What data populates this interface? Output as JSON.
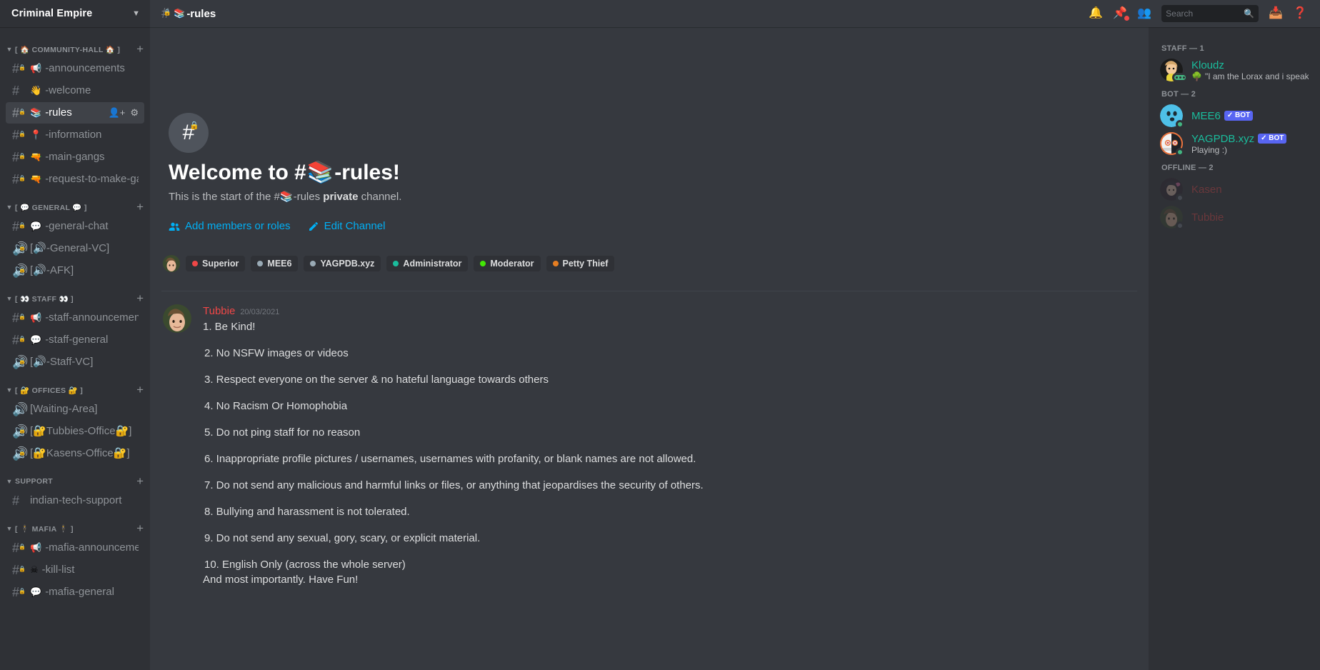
{
  "server": {
    "name": "Criminal Empire",
    "chevron_icon": "chevron-down-icon"
  },
  "sidebar": {
    "categories": [
      {
        "name": "[ 🏠 COMMUNITY-HALL 🏠 ]",
        "channels": [
          {
            "type": "text",
            "locked": true,
            "emoji": "📢",
            "label": "-announcements"
          },
          {
            "type": "text",
            "locked": false,
            "emoji": "👋",
            "label": "-welcome"
          },
          {
            "type": "text",
            "locked": true,
            "emoji": "📚",
            "label": "-rules",
            "active": true,
            "actions": [
              "add-member-icon",
              "gear-icon"
            ]
          },
          {
            "type": "text",
            "locked": true,
            "emoji": "📍",
            "label": "-information"
          },
          {
            "type": "text",
            "locked": true,
            "emoji": "🔫",
            "label": "-main-gangs"
          },
          {
            "type": "text",
            "locked": true,
            "emoji": "🔫",
            "label": "-request-to-make-gang"
          }
        ]
      },
      {
        "name": "[ 💬 GENERAL 💬 ]",
        "channels": [
          {
            "type": "text",
            "locked": true,
            "emoji": "💬",
            "label": "-general-chat"
          },
          {
            "type": "voice",
            "locked": true,
            "emoji": "🔊",
            "label": "[🔊-General-VC]",
            "raw": true
          },
          {
            "type": "voice",
            "locked": true,
            "emoji": "🔊",
            "label": "[🔊-AFK]",
            "raw": true
          }
        ]
      },
      {
        "name": "[ 👀 STAFF 👀 ]",
        "channels": [
          {
            "type": "text",
            "locked": true,
            "emoji": "📢",
            "label": "-staff-announcements"
          },
          {
            "type": "text",
            "locked": true,
            "emoji": "💬",
            "label": "-staff-general"
          },
          {
            "type": "voice",
            "locked": true,
            "emoji": "🔊",
            "label": "[🔊-Staff-VC]",
            "raw": true
          }
        ]
      },
      {
        "name": "[ 🔐 OFFICES 🔐 ]",
        "channels": [
          {
            "type": "voice",
            "locked": false,
            "emoji": "",
            "label": "[Waiting-Area]",
            "raw": true
          },
          {
            "type": "voice",
            "locked": true,
            "emoji": "🔐",
            "label": "[🔐Tubbies-Office🔐]",
            "raw": true
          },
          {
            "type": "voice",
            "locked": true,
            "emoji": "🔐",
            "label": "[🔐Kasens-Office🔐]",
            "raw": true
          }
        ]
      },
      {
        "name": "SUPPORT",
        "channels": [
          {
            "type": "text",
            "locked": false,
            "emoji": "",
            "label": "indian-tech-support"
          }
        ]
      },
      {
        "name": "[ 🕴 MAFIA 🕴 ]",
        "channels": [
          {
            "type": "text",
            "locked": true,
            "emoji": "📢",
            "label": "-mafia-announcements"
          },
          {
            "type": "text",
            "locked": true,
            "emoji": "☠",
            "label": "-kill-list"
          },
          {
            "type": "text",
            "locked": true,
            "emoji": "💬",
            "label": "-mafia-general"
          }
        ]
      }
    ],
    "add_channel_icon": "plus-icon"
  },
  "topbar": {
    "hash_icon": "hash-locked-icon",
    "channel_emoji": "📚",
    "channel_name": "-rules",
    "icons": [
      "bell-icon",
      "pin-icon",
      "members-icon",
      "inbox-icon",
      "help-icon"
    ],
    "search_placeholder": "Search",
    "search_value": "",
    "search_icon": "search-icon",
    "pin_badge_color": "#f04747"
  },
  "hero": {
    "icon": "hash-locked-icon",
    "title_prefix": "Welcome to #",
    "title_emoji": "📚",
    "title_suffix": "-rules!",
    "sub_prefix": "This is the start of the #",
    "sub_emoji": "📚",
    "sub_mid": "-rules ",
    "sub_bold": "private",
    "sub_suffix": " channel.",
    "actions": [
      {
        "icon": "add-members-icon",
        "label": "Add members or roles"
      },
      {
        "icon": "pencil-icon",
        "label": "Edit Channel"
      }
    ]
  },
  "role_pills": [
    {
      "label": "Superior",
      "color": "#f04747"
    },
    {
      "label": "MEE6",
      "color": "#99aab5"
    },
    {
      "label": "YAGPDB.xyz",
      "color": "#99aab5"
    },
    {
      "label": "Administrator",
      "color": "#1abc9c"
    },
    {
      "label": "Moderator",
      "color": "#43e606"
    },
    {
      "label": "Petty Thief",
      "color": "#e67e22"
    }
  ],
  "message": {
    "author": "Tubbie",
    "author_color": "#f04747",
    "timestamp": "20/03/2021",
    "lines": [
      "1. Be Kind!",
      "2. No NSFW images or videos",
      "3. Respect everyone on the server & no hateful language towards others",
      "4. No Racism Or Homophobia",
      "5. Do not ping staff for no reason",
      "6. Inappropriate profile pictures / usernames, usernames with profanity, or blank names are not allowed.",
      "7. Do not send any malicious and harmful links or files, or anything that jeopardises the security of others.",
      "8. Bullying and harassment is not tolerated.",
      "9. Do not send any sexual, gory, scary, or explicit material.",
      "10. English Only (across the whole server)"
    ],
    "closing": "And most importantly. Have Fun!"
  },
  "members": {
    "groups": [
      {
        "title": "STAFF — 1",
        "people": [
          {
            "name": "Kloudz",
            "name_color": "#1abc9c",
            "status": "typing",
            "sub_emoji": "🌳",
            "sub": "\"I am the Lorax and i speak...",
            "bot": false,
            "offline": false
          }
        ]
      },
      {
        "title": "BOT — 2",
        "people": [
          {
            "name": "MEE6",
            "name_color": "#1abc9c",
            "status": "online",
            "sub_emoji": "",
            "sub": "",
            "bot": true,
            "bot_label": "BOT",
            "offline": false
          },
          {
            "name": "YAGPDB.xyz",
            "name_color": "#1abc9c",
            "status": "online",
            "sub_emoji": "",
            "sub": "Playing :)",
            "bot": true,
            "bot_label": "BOT",
            "offline": false
          }
        ]
      },
      {
        "title": "OFFLINE — 2",
        "people": [
          {
            "name": "Kasen",
            "name_color": "#f04747",
            "status": "offline",
            "sub_emoji": "",
            "sub": "",
            "bot": false,
            "offline": true
          },
          {
            "name": "Tubbie",
            "name_color": "#f04747",
            "status": "offline",
            "sub_emoji": "",
            "sub": "",
            "bot": false,
            "offline": true
          }
        ]
      }
    ]
  }
}
